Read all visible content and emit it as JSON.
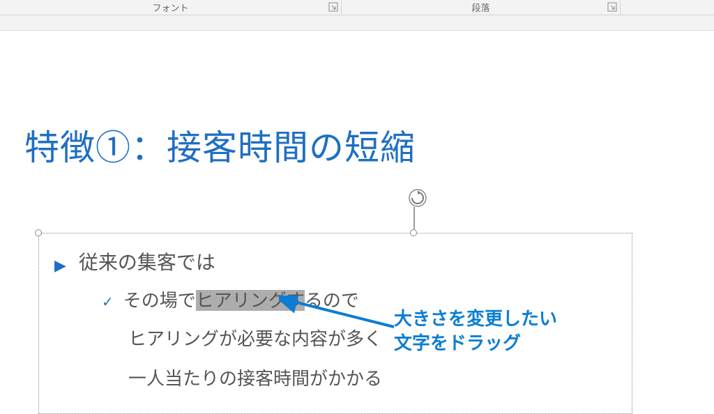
{
  "ribbon": {
    "font_label": "フォント",
    "paragraph_label": "段落"
  },
  "slide": {
    "title": "特徴①：接客時間の短縮",
    "bullets": {
      "level1": "従来の集客では",
      "level2_pre": "その場で",
      "level2_highlight": "ヒアリング",
      "level2_highlight2": "す",
      "level2_post": "るので",
      "level3a": "ヒアリングが必要な内容が多く",
      "level3b": "一人当たりの接客時間がかかる"
    }
  },
  "annotation": {
    "line1": "大きさを変更したい",
    "line2": "文字をドラッグ"
  }
}
